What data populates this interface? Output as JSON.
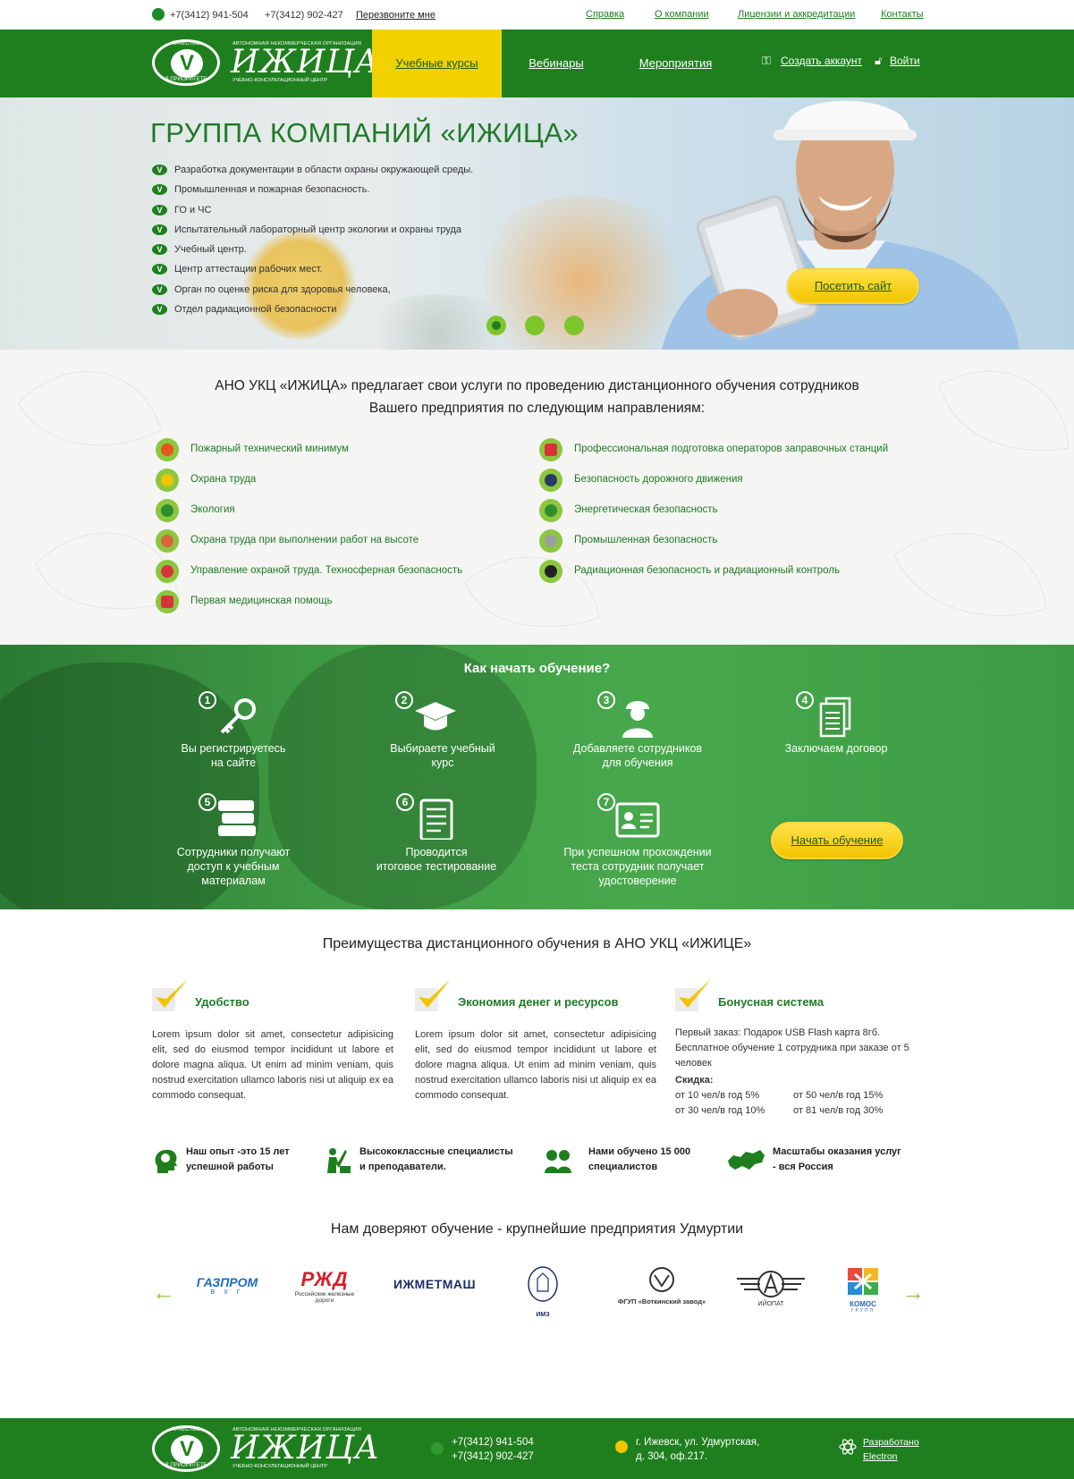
{
  "topbar": {
    "phone1": "+7(3412) 941-504",
    "phone2": "+7(3412) 902-427",
    "callback": "Перезвоните мне",
    "links": [
      "Справка",
      "О компании",
      "Лицензии и аккредитации",
      "Контакты"
    ]
  },
  "logo": {
    "seal_top": "КАЧЕСТВО",
    "seal_bottom": "В ПРИОРИТЕТЕ",
    "seal_letter": "V",
    "line1": "АВТОНОМНАЯ НЕКОММЕРЧЕСКАЯ ОРГАНИЗАЦИЯ",
    "name": "ИЖИЦА",
    "line2": "УЧЕБНО-КОНСУЛЬТАЦИОННЫЙ ЦЕНТР"
  },
  "nav": {
    "items": [
      "Учебные курсы",
      "Вебинары",
      "Мероприятия"
    ],
    "active": "Учебные курсы",
    "create_account": "Создать аккаунт",
    "login": "Войти"
  },
  "hero": {
    "title": "ГРУППА КОМПАНИЙ «ИЖИЦА»",
    "bullet": "V",
    "items": [
      "Разработка документации в области охраны окружающей среды.",
      "Промышленная и пожарная безопасность.",
      "ГО и ЧС",
      "Испытательный лабораторный центр экологии и охраны труда",
      "Учебный центр.",
      "Центр аттестации рабочих мест.",
      "Орган по оценке риска для здоровья человека,",
      "Отдел радиационной безопасности"
    ],
    "button": "Посетить сайт",
    "slides": 3,
    "active_slide": 1
  },
  "services": {
    "intro_line1": "АНО УКЦ «ИЖИЦА» предлагает свои услуги по проведению дистанционного обучения сотрудников",
    "intro_line2": "Вашего предприятия по следующим направлениям:",
    "left": [
      {
        "label": "Пожарный технический минимум",
        "icon": "fire-icon",
        "color": "#e8541c"
      },
      {
        "label": "Охрана труда",
        "icon": "helmet-icon",
        "color": "#f2c400"
      },
      {
        "label": "Экология",
        "icon": "leaf-icon",
        "color": "#2f8f2f"
      },
      {
        "label": "Охрана труда при выполнении работ на высоте",
        "icon": "carabiner-icon",
        "color": "#d8663a"
      },
      {
        "label": "Управление охраной труда. Техносферная безопасность",
        "icon": "cone-icon",
        "color": "#d8323a"
      },
      {
        "label": "Первая медицинская помощь",
        "icon": "first-aid-icon",
        "color": "#d8323a"
      }
    ],
    "right": [
      {
        "label": "Профессиональная подготовка операторов заправочных станций",
        "icon": "fuel-can-icon",
        "color": "#d8323a"
      },
      {
        "label": "Безопасность дорожного движения",
        "icon": "road-icon",
        "color": "#2a3a66"
      },
      {
        "label": "Энергетическая безопасность",
        "icon": "energy-icon",
        "color": "#2f8f2f"
      },
      {
        "label": "Промышленная безопасность",
        "icon": "gears-icon",
        "color": "#9aa0a0"
      },
      {
        "label": "Радиационная безопасность и радиационный контроль",
        "icon": "radiation-icon",
        "color": "#222222"
      }
    ]
  },
  "howto": {
    "title": "Как начать обучение?",
    "steps": [
      {
        "num": "1",
        "text_l1": "Вы регистрируетесь",
        "text_l2": "на сайте",
        "text_l3": "",
        "icon": "keys-icon"
      },
      {
        "num": "2",
        "text_l1": "Выбираете учебный",
        "text_l2": "курс",
        "text_l3": "",
        "icon": "graduation-cap-icon"
      },
      {
        "num": "3",
        "text_l1": "Добавляете сотрудников",
        "text_l2": "для обучения",
        "text_l3": "",
        "icon": "worker-icon"
      },
      {
        "num": "4",
        "text_l1": "Заключаем договор",
        "text_l2": "",
        "text_l3": "",
        "icon": "documents-icon"
      },
      {
        "num": "5",
        "text_l1": "Сотрудники получают",
        "text_l2": "доступ к учебным",
        "text_l3": "материалам",
        "icon": "books-icon"
      },
      {
        "num": "6",
        "text_l1": "Проводится",
        "text_l2": "итоговое тестирование",
        "text_l3": "",
        "icon": "test-icon"
      },
      {
        "num": "7",
        "text_l1": "При успешном прохождении",
        "text_l2": "теста сотрудник получает",
        "text_l3": "удостоверение",
        "icon": "id-card-icon"
      }
    ],
    "button": "Начать обучение"
  },
  "advantages": {
    "title": "Преимущества дистанционного обучения в АНО УКЦ «ИЖИЦЕ»",
    "items": [
      {
        "heading": "Удобство",
        "text": "Lorem ipsum dolor sit amet, consectetur adipisicing elit, sed do eiusmod tempor incididunt ut labore et dolore magna aliqua. Ut enim ad minim veniam, quis nostrud exercitation ullamco laboris nisi ut aliquip ex ea commodo consequat."
      },
      {
        "heading": "Экономия денег и ресурсов",
        "text": "Lorem ipsum dolor sit amet, consectetur adipisicing elit, sed do eiusmod tempor incididunt ut labore et dolore magna aliqua. Ut enim ad minim veniam, quis nostrud exercitation ullamco laboris nisi ut aliquip ex ea commodo consequat."
      },
      {
        "heading": "Бонусная система",
        "text": ""
      }
    ],
    "bonus": {
      "line1": "Первый заказ: Подарок USB Flash карта 8гб.",
      "line2": "Бесплатное обучение 1 сотрудника при заказе от 5 человек",
      "discount_label": "Скидка:",
      "d1": "от 10 чел/в год 5%",
      "d2": "от 50 чел/в год 15%",
      "d3": "от 30 чел/в год  10%",
      "d4": "от 81 чел/в год  30%"
    },
    "facts": [
      {
        "l1": "Наш опыт -это 15 лет",
        "l2": "успешной работы",
        "icon": "head-icon"
      },
      {
        "l1": "Высококлассные специалисты",
        "l2": "и преподаватели.",
        "icon": "teacher-icon"
      },
      {
        "l1": "Нами обучено 15 000",
        "l2": "специалистов",
        "icon": "people-icon"
      },
      {
        "l1": "Масштабы оказания услуг",
        "l2": "- вся Россия",
        "icon": "russia-map-icon"
      }
    ]
  },
  "partners": {
    "title": "Нам доверяют обучение - крупнейшие предприятия Удмуртии",
    "logos": [
      {
        "name": "ГАЗПРОМ",
        "sub": "В Х Г",
        "color": "#1a6cc8"
      },
      {
        "name": "РЖД",
        "sub": "Российские железные дороги",
        "color": "#d61f26"
      },
      {
        "name": "ИЖМЕТМАШ",
        "sub": "",
        "color": "#1c2e6a"
      },
      {
        "name": "ИМЗ",
        "sub": "",
        "color": "#1c2e6a"
      },
      {
        "name": "ФГУП «Воткинский завод»",
        "sub": "",
        "color": "#333333"
      },
      {
        "name": "ИЙОПАТ",
        "sub": "",
        "color": "#333333"
      },
      {
        "name": "КОМОС",
        "sub": "ГРУПП",
        "color": "#2a66b8"
      }
    ]
  },
  "footer": {
    "phone1": "+7(3412) 941-504",
    "phone2": "+7(3412) 902-427",
    "address1": "г. Ижевск, ул. Удмуртская,",
    "address2": "д. 304, оф.217.",
    "dev1": "Разработано",
    "dev2": "Electron"
  },
  "colors": {
    "green": "#1f7f1e",
    "yellow": "#f2d100",
    "link": "#1f7a26"
  }
}
